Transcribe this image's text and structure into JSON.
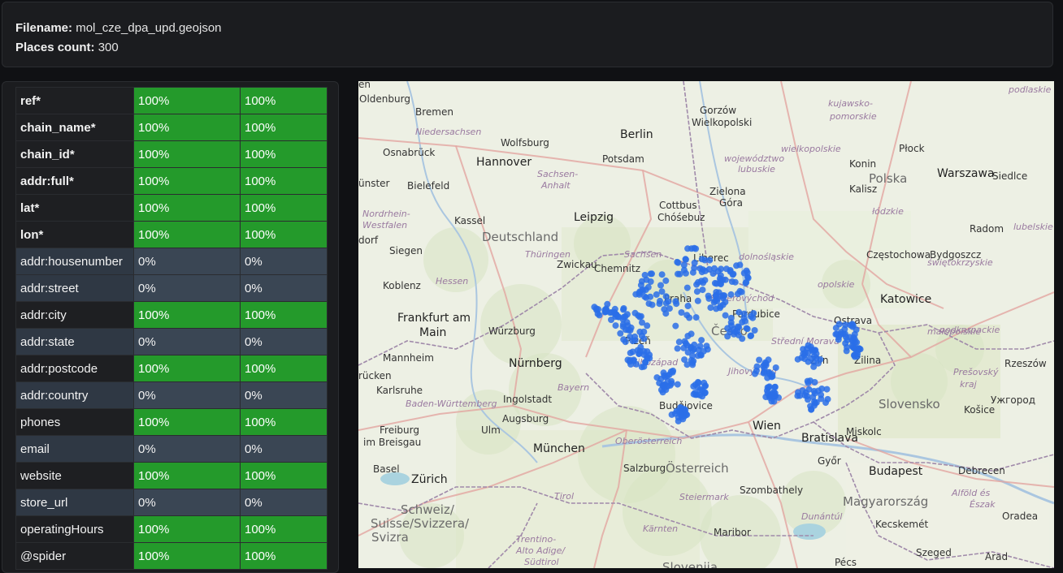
{
  "info": {
    "filename_label": "Filename:",
    "filename_value": "mol_cze_dpa_upd.geojson",
    "places_label": "Places count:",
    "places_value": "300"
  },
  "table": {
    "rows": [
      {
        "name": "ref*",
        "v1": "100%",
        "v2": "100%",
        "required": true
      },
      {
        "name": "chain_name*",
        "v1": "100%",
        "v2": "100%",
        "required": true
      },
      {
        "name": "chain_id*",
        "v1": "100%",
        "v2": "100%",
        "required": true
      },
      {
        "name": "addr:full*",
        "v1": "100%",
        "v2": "100%",
        "required": true
      },
      {
        "name": "lat*",
        "v1": "100%",
        "v2": "100%",
        "required": true
      },
      {
        "name": "lon*",
        "v1": "100%",
        "v2": "100%",
        "required": true
      },
      {
        "name": "addr:housenumber",
        "v1": "0%",
        "v2": "0%",
        "required": false
      },
      {
        "name": "addr:street",
        "v1": "0%",
        "v2": "0%",
        "required": false
      },
      {
        "name": "addr:city",
        "v1": "100%",
        "v2": "100%",
        "required": false
      },
      {
        "name": "addr:state",
        "v1": "0%",
        "v2": "0%",
        "required": false
      },
      {
        "name": "addr:postcode",
        "v1": "100%",
        "v2": "100%",
        "required": false
      },
      {
        "name": "addr:country",
        "v1": "0%",
        "v2": "0%",
        "required": false
      },
      {
        "name": "phones",
        "v1": "100%",
        "v2": "100%",
        "required": false
      },
      {
        "name": "email",
        "v1": "0%",
        "v2": "0%",
        "required": false
      },
      {
        "name": "website",
        "v1": "100%",
        "v2": "100%",
        "required": false
      },
      {
        "name": "store_url",
        "v1": "0%",
        "v2": "0%",
        "required": false
      },
      {
        "name": "operatingHours",
        "v1": "100%",
        "v2": "100%",
        "required": false
      },
      {
        "name": "@spider",
        "v1": "100%",
        "v2": "100%",
        "required": false
      }
    ]
  },
  "map": {
    "labels": [
      {
        "t": "Bremen",
        "c": "city"
      },
      {
        "t": "Oldenburg",
        "c": "city"
      },
      {
        "t": "Niedersachsen",
        "c": "region"
      },
      {
        "t": "Hannover",
        "c": "city-big"
      },
      {
        "t": "Osnabrück",
        "c": "city"
      },
      {
        "t": "Bielefeld",
        "c": "city"
      },
      {
        "t": "Wolfsburg",
        "c": "city"
      },
      {
        "t": "Berlin",
        "c": "city-big"
      },
      {
        "t": "Potsdam",
        "c": "city"
      },
      {
        "t": "Gorzów",
        "c": "city"
      },
      {
        "t": "Wielkopolski",
        "c": "city"
      },
      {
        "t": "województwo",
        "c": "region"
      },
      {
        "t": "lubuskie",
        "c": "region"
      },
      {
        "t": "wielkopolskie",
        "c": "region"
      },
      {
        "t": "kujawsko-",
        "c": "region"
      },
      {
        "t": "pomorskie",
        "c": "region"
      },
      {
        "t": "Płock",
        "c": "city"
      },
      {
        "t": "Konin",
        "c": "city"
      },
      {
        "t": "Polska",
        "c": "country"
      },
      {
        "t": "Warszawa",
        "c": "city-big"
      },
      {
        "t": "Siedlce",
        "c": "city"
      },
      {
        "t": "Sachsen-",
        "c": "region"
      },
      {
        "t": "Anhalt",
        "c": "region"
      },
      {
        "t": "Cottbus",
        "c": "city"
      },
      {
        "t": "Chóśebuz",
        "c": "city"
      },
      {
        "t": "Zielona",
        "c": "city"
      },
      {
        "t": "Góra",
        "c": "city"
      },
      {
        "t": "Kalisz",
        "c": "city"
      },
      {
        "t": "łódzkie",
        "c": "region"
      },
      {
        "t": "Kassel",
        "c": "city"
      },
      {
        "t": "Leipzig",
        "c": "city-big"
      },
      {
        "t": "Nordrhein-",
        "c": "region"
      },
      {
        "t": "Westfalen",
        "c": "region"
      },
      {
        "t": "Deutschland",
        "c": "country"
      },
      {
        "t": "Radom",
        "c": "city"
      },
      {
        "t": "Siegen",
        "c": "city"
      },
      {
        "t": "Thüringen",
        "c": "region"
      },
      {
        "t": "Sachsen",
        "c": "region"
      },
      {
        "t": "Chemnitz",
        "c": "city"
      },
      {
        "t": "Liberec",
        "c": "city"
      },
      {
        "t": "dolnośląskie",
        "c": "region"
      },
      {
        "t": "Częstochowa",
        "c": "city"
      },
      {
        "t": "świętokrzyskie",
        "c": "region"
      },
      {
        "t": "Koblenz",
        "c": "city"
      },
      {
        "t": "Hessen",
        "c": "region"
      },
      {
        "t": "opolskie",
        "c": "region"
      },
      {
        "t": "Katowice",
        "c": "city-big"
      },
      {
        "t": "Praha",
        "c": "city"
      },
      {
        "t": "Severovýchod",
        "c": "region"
      },
      {
        "t": "Pardubice",
        "c": "city"
      },
      {
        "t": "Frankfurt am",
        "c": "city-big"
      },
      {
        "t": "Main",
        "c": "city-big"
      },
      {
        "t": "Würzburg",
        "c": "city"
      },
      {
        "t": "Plzeň",
        "c": "city"
      },
      {
        "t": "Česko",
        "c": "country"
      },
      {
        "t": "Ostrava",
        "c": "city"
      },
      {
        "t": "małopolskie",
        "c": "region"
      },
      {
        "t": "podkarpackie",
        "c": "region"
      },
      {
        "t": "Mannheim",
        "c": "city"
      },
      {
        "t": "Nürnberg",
        "c": "city-big"
      },
      {
        "t": "Jihozápad",
        "c": "region"
      },
      {
        "t": "Jihovýchod",
        "c": "region"
      },
      {
        "t": "Střední Morava",
        "c": "region"
      },
      {
        "t": "Zlín",
        "c": "city"
      },
      {
        "t": "Žilina",
        "c": "city"
      },
      {
        "t": "Karlsruhe",
        "c": "city"
      },
      {
        "t": "Bayern",
        "c": "region"
      },
      {
        "t": "Baden-Württemberg",
        "c": "region"
      },
      {
        "t": "Ingolstadt",
        "c": "city"
      },
      {
        "t": "Budějovice",
        "c": "city"
      },
      {
        "t": "Slovensko",
        "c": "country"
      },
      {
        "t": "Prešovský",
        "c": "region"
      },
      {
        "t": "kraj",
        "c": "region"
      },
      {
        "t": "Ужгород",
        "c": "city"
      },
      {
        "t": "Košice",
        "c": "city"
      },
      {
        "t": "Augsburg",
        "c": "city"
      },
      {
        "t": "Wien",
        "c": "city-big"
      },
      {
        "t": "Bratislava",
        "c": "city-big"
      },
      {
        "t": "Freiburg",
        "c": "city"
      },
      {
        "t": "im Breisgau",
        "c": "city"
      },
      {
        "t": "Ulm",
        "c": "city"
      },
      {
        "t": "Oberösterreich",
        "c": "region"
      },
      {
        "t": "Miskolc",
        "c": "city"
      },
      {
        "t": "München",
        "c": "city-big"
      },
      {
        "t": "Basel",
        "c": "city"
      },
      {
        "t": "Salzburg",
        "c": "city"
      },
      {
        "t": "Österreich",
        "c": "country"
      },
      {
        "t": "Győr",
        "c": "city"
      },
      {
        "t": "Budapest",
        "c": "city-big"
      },
      {
        "t": "Debrecen",
        "c": "city"
      },
      {
        "t": "Zürich",
        "c": "city-big"
      },
      {
        "t": "Tirol",
        "c": "region"
      },
      {
        "t": "Steiermark",
        "c": "region"
      },
      {
        "t": "Szombathely",
        "c": "city"
      },
      {
        "t": "Alföld és",
        "c": "region"
      },
      {
        "t": "Észak",
        "c": "region"
      },
      {
        "t": "Schweiz/",
        "c": "country"
      },
      {
        "t": "Suisse/Svizzera/",
        "c": "country"
      },
      {
        "t": "Svizra",
        "c": "country"
      },
      {
        "t": "Dunántúl",
        "c": "region"
      },
      {
        "t": "Magyarország",
        "c": "country"
      },
      {
        "t": "Oradea",
        "c": "city"
      },
      {
        "t": "Kärnten",
        "c": "region"
      },
      {
        "t": "Maribor",
        "c": "city"
      },
      {
        "t": "Kecskemét",
        "c": "city"
      },
      {
        "t": "Trentino-",
        "c": "region"
      },
      {
        "t": "Alto Adige/",
        "c": "region"
      },
      {
        "t": "Südtirol",
        "c": "region"
      },
      {
        "t": "Slovenija",
        "c": "country"
      },
      {
        "t": "Pécs",
        "c": "city"
      },
      {
        "t": "Szeged",
        "c": "city"
      },
      {
        "t": "Arad",
        "c": "city"
      },
      {
        "t": "Zwickau",
        "c": "city"
      },
      {
        "t": "Bydgoszcz",
        "c": "city"
      },
      {
        "t": "podlaskie",
        "c": "region"
      },
      {
        "t": "lubelskie",
        "c": "region"
      },
      {
        "t": "Rzeszów",
        "c": "city"
      },
      {
        "t": "dorf",
        "c": "city"
      },
      {
        "t": "ünster",
        "c": "city"
      },
      {
        "t": "rücken",
        "c": "city"
      },
      {
        "t": "en",
        "c": "city"
      }
    ],
    "marker_color": "#2a6fe8"
  }
}
